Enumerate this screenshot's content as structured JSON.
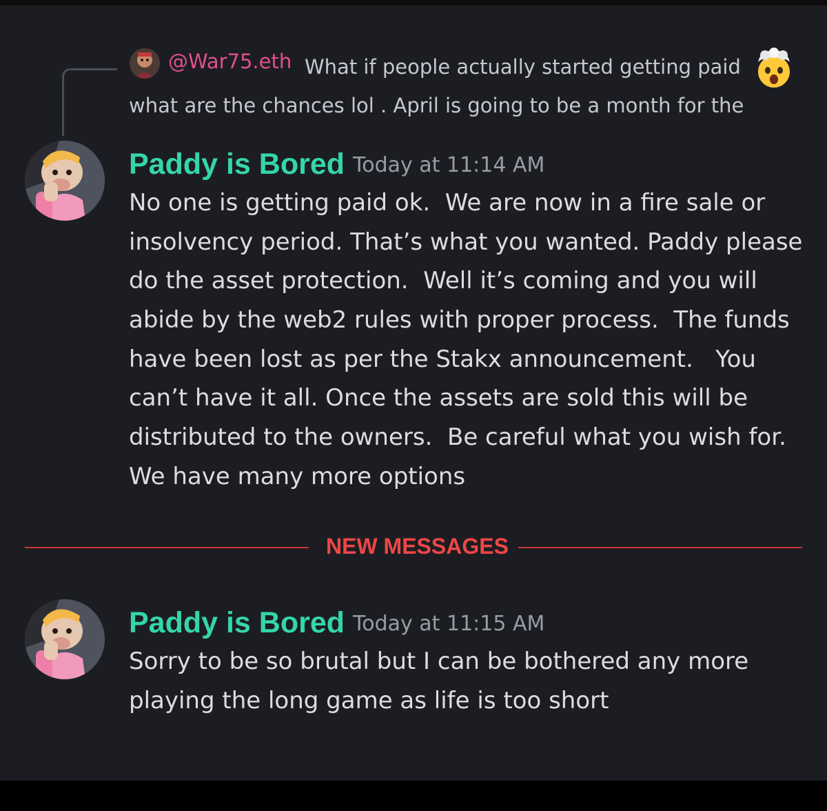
{
  "reply": {
    "author": "@War75.eth",
    "text_line1": "What if people actually started getting paid",
    "text_line2": "what are the chances lol . April is going to be a month for the",
    "emoji": "exploding-head-emoji"
  },
  "messages": [
    {
      "author": "Paddy is Bored",
      "timestamp": "Today at 11:14 AM",
      "lines": [
        "No one is getting paid ok.  We are now in a fire sale or",
        "insolvency period. That’s what you wanted. Paddy please",
        "do the asset protection.  Well it’s coming and you will",
        "abide by the web2 rules with proper process.  The funds",
        "have been lost as per the Stakx announcement.   You",
        "can’t have it all. Once the assets are sold this will be",
        "distributed to the owners.  Be careful what you wish for.",
        "We have many more options"
      ]
    },
    {
      "author": "Paddy is Bored",
      "timestamp": "Today at 11:15 AM",
      "lines": [
        "Sorry to be so brutal but I can be bothered any more",
        "playing the long game as life is too short"
      ]
    }
  ],
  "divider": {
    "label": "NEW MESSAGES"
  },
  "colors": {
    "background": "#1c1d22",
    "author": "#34d6a8",
    "reply_author": "#e0508a",
    "new_messages": "#ee4646",
    "timestamp": "#9a9ca4",
    "text": "#dcdde2"
  }
}
